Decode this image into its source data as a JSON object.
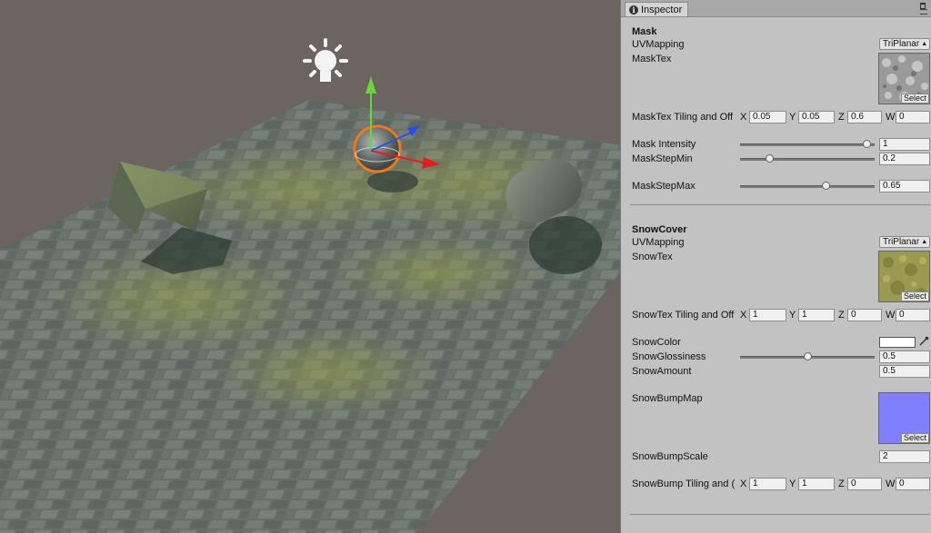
{
  "inspector": {
    "tab_label": "Inspector",
    "mask": {
      "header": "Mask",
      "uvmapping_label": "UVMapping",
      "uvmapping_value": "TriPlanar",
      "masktex_label": "MaskTex",
      "select_label": "Select",
      "tiling_label": "MaskTex Tiling and Off",
      "tiling": {
        "x": "0.05",
        "y": "0.05",
        "z": "0.6",
        "w": "0"
      },
      "intensity_label": "Mask Intensity",
      "intensity_value": "1",
      "intensity_level": 0.97,
      "stepmin_label": "MaskStepMin",
      "stepmin_value": "0.2",
      "stepmin_level": 0.2,
      "stepmax_label": "MaskStepMax",
      "stepmax_value": "0.65",
      "stepmax_level": 0.65
    },
    "snow": {
      "header": "SnowCover",
      "uvmapping_label": "UVMapping",
      "uvmapping_value": "TriPlanar",
      "snowtex_label": "SnowTex",
      "select_label": "Select",
      "tiling_label": "SnowTex Tiling and Off",
      "tiling": {
        "x": "1",
        "y": "1",
        "z": "0",
        "w": "0"
      },
      "color_label": "SnowColor",
      "color_value": "#ffffff",
      "gloss_label": "SnowGlossiness",
      "gloss_value": "0.5",
      "gloss_level": 0.5,
      "amount_label": "SnowAmount",
      "amount_value": "0.5",
      "bumpmap_label": "SnowBumpMap",
      "bump_select_label": "Select",
      "bumpscale_label": "SnowBumpScale",
      "bumpscale_value": "2",
      "bump_tiling_label": "SnowBump Tiling and (",
      "bump_tiling": {
        "x": "1",
        "y": "1",
        "z": "0",
        "w": "0"
      }
    },
    "axis": {
      "x": "X",
      "y": "Y",
      "z": "Z",
      "w": "W"
    }
  },
  "scene": {
    "background_color": "#6b6460",
    "selection_outline_color": "#f07820"
  }
}
